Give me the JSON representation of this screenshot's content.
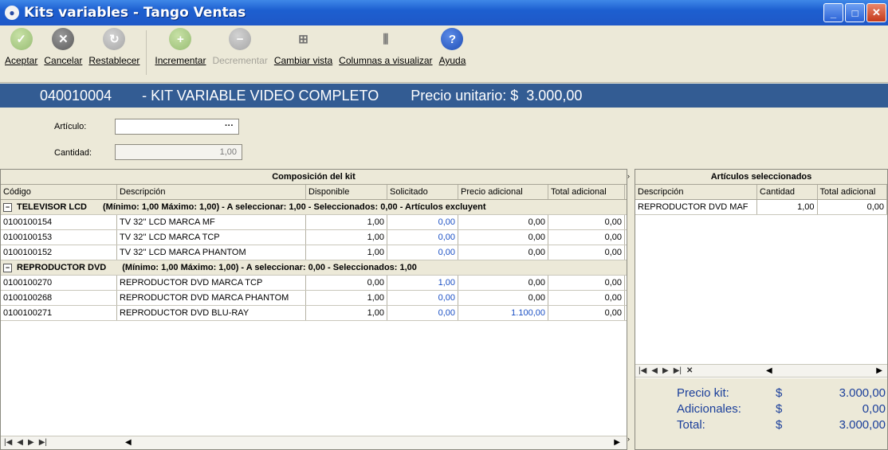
{
  "window": {
    "title": "Kits variables - Tango Ventas",
    "icon": "app-logo-icon"
  },
  "toolbar": {
    "aceptar": "Aceptar",
    "cancelar": "Cancelar",
    "restablecer": "Restablecer",
    "incrementar": "Incrementar",
    "decrementar": "Decrementar",
    "cambiar_vista": "Cambiar vista",
    "columnas": "Columnas a visualizar",
    "ayuda": "Ayuda"
  },
  "banner": {
    "code": "040010004",
    "description": "- KIT VARIABLE VIDEO COMPLETO",
    "price_label": "Precio unitario: $",
    "price_value": "3.000,00"
  },
  "form": {
    "articulo_label": "Artículo:",
    "articulo_value": "",
    "cantidad_label": "Cantidad:",
    "cantidad_value": "1,00"
  },
  "composition": {
    "title": "Composición del kit",
    "columns": [
      "Código",
      "Descripción",
      "Disponible",
      "Solicitado",
      "Precio adicional",
      "Total adicional"
    ],
    "groups": [
      {
        "name": "TELEVISOR LCD",
        "info": "(Mínimo: 1,00 Máximo: 1,00)  -   A seleccionar: 1,00  -   Seleccionados: 0,00  -  Artículos excluyent",
        "rows": [
          [
            "0100100154",
            "TV 32'' LCD MARCA MF",
            "1,00",
            "0,00",
            "0,00",
            "0,00"
          ],
          [
            "0100100153",
            "TV 32'' LCD MARCA TCP",
            "1,00",
            "0,00",
            "0,00",
            "0,00"
          ],
          [
            "0100100152",
            "TV 32'' LCD MARCA PHANTOM",
            "1,00",
            "0,00",
            "0,00",
            "0,00"
          ]
        ]
      },
      {
        "name": "REPRODUCTOR DVD",
        "info": "(Mínimo: 1,00 Máximo: 1,00)  -   A seleccionar: 0,00  -   Seleccionados: 1,00",
        "rows": [
          [
            "0100100270",
            "REPRODUCTOR DVD MARCA TCP",
            "0,00",
            "1,00",
            "0,00",
            "0,00"
          ],
          [
            "0100100268",
            "REPRODUCTOR DVD MARCA PHANTOM",
            "1,00",
            "0,00",
            "0,00",
            "0,00"
          ],
          [
            "0100100271",
            "REPRODUCTOR DVD BLU-RAY",
            "1,00",
            "0,00",
            "1.100,00",
            "0,00"
          ]
        ]
      }
    ]
  },
  "selected": {
    "title": "Artículos seleccionados",
    "columns": [
      "Descripción",
      "Cantidad",
      "Total adicional"
    ],
    "rows": [
      [
        "REPRODUCTOR DVD MAF",
        "1,00",
        "0,00"
      ]
    ]
  },
  "totals": {
    "precio_kit_label": "Precio kit:",
    "precio_kit_value": "3.000,00",
    "adicionales_label": "Adicionales:",
    "adicionales_value": "0,00",
    "total_label": "Total:",
    "total_value": "3.000,00",
    "currency": "$"
  },
  "colors": {
    "banner": "#335c93",
    "accent_blue": "#1a4fc4",
    "titlebar": "#1f58c7"
  }
}
